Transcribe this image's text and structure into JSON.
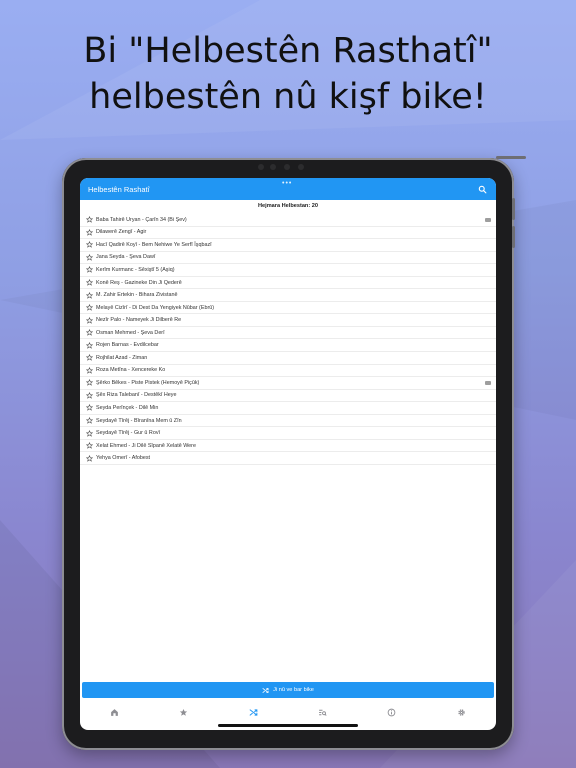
{
  "headline": {
    "line1": "Bi \"Helbestên Rasthatî\"",
    "line2": "helbestên nû kişf bike!"
  },
  "app": {
    "title": "Helbestên Rashatî",
    "count_label": "Hejmara Helbestan: 20",
    "poems": [
      {
        "label": "Baba Tahirê Uryan - Çarîn 34 (Bi Şev)",
        "badge": true
      },
      {
        "label": "Dilawerê Zengî - Agir",
        "badge": false
      },
      {
        "label": "Hacî Qadirê Koyî - Bem Nehiwe Ye Serfî Îşqbazî",
        "badge": false
      },
      {
        "label": "Jana Seyda - Şeva Dawî",
        "badge": false
      },
      {
        "label": "Kerîm Kurmanc - Sêxiştî 5 (Aşiq)",
        "badge": false
      },
      {
        "label": "Konê Reş - Gazineke Din Ji Qederê",
        "badge": false
      },
      {
        "label": "M. Zahir Ertekin - Bihara Zivistanê",
        "badge": false
      },
      {
        "label": "Melayê Cizîrî - Di Dest Da Yengiyek Nûbar (Ebrû)",
        "badge": false
      },
      {
        "label": "Nezîr Palo - Nameyek Ji Dilberê Re",
        "badge": false
      },
      {
        "label": "Osman Mehmed - Şeva Derî",
        "badge": false
      },
      {
        "label": "Rojen Barnas - Evdilcebar",
        "badge": false
      },
      {
        "label": "Rojhilat Azad - Ziman",
        "badge": false
      },
      {
        "label": "Roza Metîna - Xencereke Ko",
        "badge": false
      },
      {
        "label": "Şêrko Bêkes - Piste Pistek (Hemoyê Piçûk)",
        "badge": true
      },
      {
        "label": "Şêx Riza Talebanî - Destêkî Heye",
        "badge": false
      },
      {
        "label": "Seyda Perînçek - Dilê Min",
        "badge": false
      },
      {
        "label": "Seydayê Tîrêj - Bîranîna Mem û Zîn",
        "badge": false
      },
      {
        "label": "Seydayê Tîrêj - Gur û Rovî",
        "badge": false
      },
      {
        "label": "Xelat Ehmed - Ji Dilê Sîpanê Xelatê Were",
        "badge": false
      },
      {
        "label": "Yehya Omerî - Afobest",
        "badge": false
      }
    ],
    "action_button": "Ji nû ve bar bike",
    "tabs": [
      "home-icon",
      "star-icon",
      "shuffle-icon",
      "search-list-icon",
      "info-icon",
      "gear-icon"
    ]
  },
  "colors": {
    "primary": "#2196f3",
    "active_tab": "#2196f3",
    "inactive_tab": "#8e8e93"
  }
}
